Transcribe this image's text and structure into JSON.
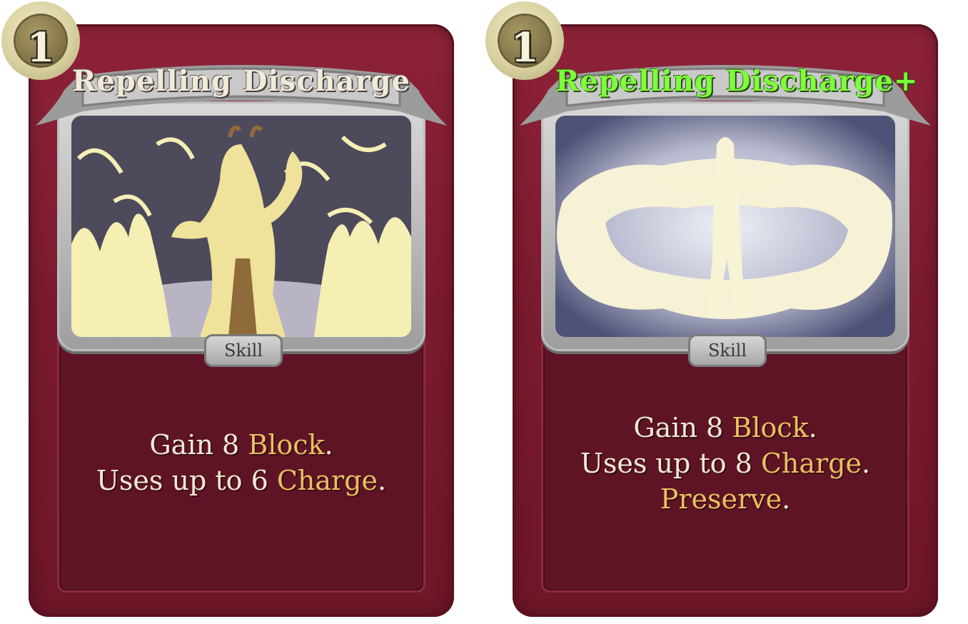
{
  "cards": [
    {
      "cost": "1",
      "title": "Repelling Discharge",
      "type": "Skill",
      "desc": {
        "l1a": "Gain 8 ",
        "l1k": "Block",
        "l1b": ".",
        "l2a": "Uses up to 6 ",
        "l2k": "Charge",
        "l2b": "."
      }
    },
    {
      "cost": "1",
      "title": "Repelling Discharge+",
      "type": "Skill",
      "desc": {
        "l1a": "Gain 8 ",
        "l1k": "Block",
        "l1b": ".",
        "l2a": "Uses up to 8 ",
        "l2k": "Charge",
        "l2b": ".",
        "l3k": "Preserve",
        "l3b": "."
      }
    }
  ],
  "colors": {
    "card": "#7a1a2e",
    "keyword": "#e8c060",
    "upgraded_title": "#7dff3a"
  }
}
